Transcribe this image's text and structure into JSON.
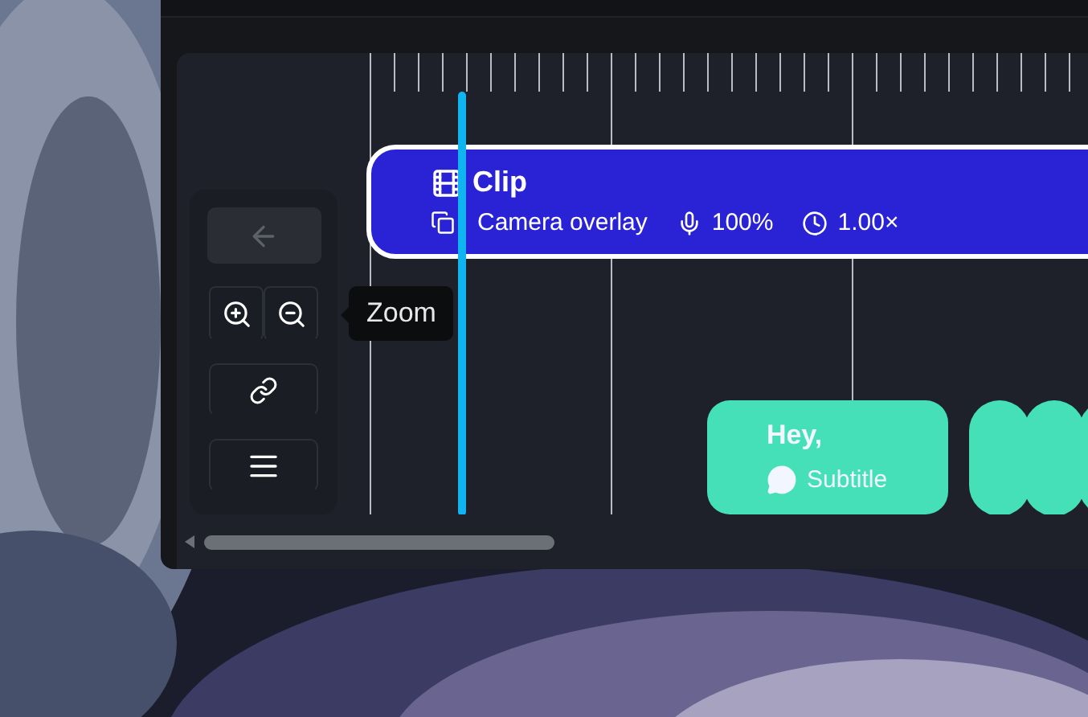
{
  "controls": [
    {
      "kind": "back",
      "disabled": true
    },
    {
      "kind": "zoom",
      "disabled": false
    },
    {
      "kind": "link",
      "disabled": false
    },
    {
      "kind": "menu",
      "disabled": false
    }
  ],
  "tooltip": {
    "text": "Zoom"
  },
  "clip": {
    "title": "Clip",
    "source": "Camera overlay",
    "volume": "100%",
    "speed": "1.00×"
  },
  "subtitle": {
    "text": "Hey,",
    "label": "Subtitle"
  }
}
